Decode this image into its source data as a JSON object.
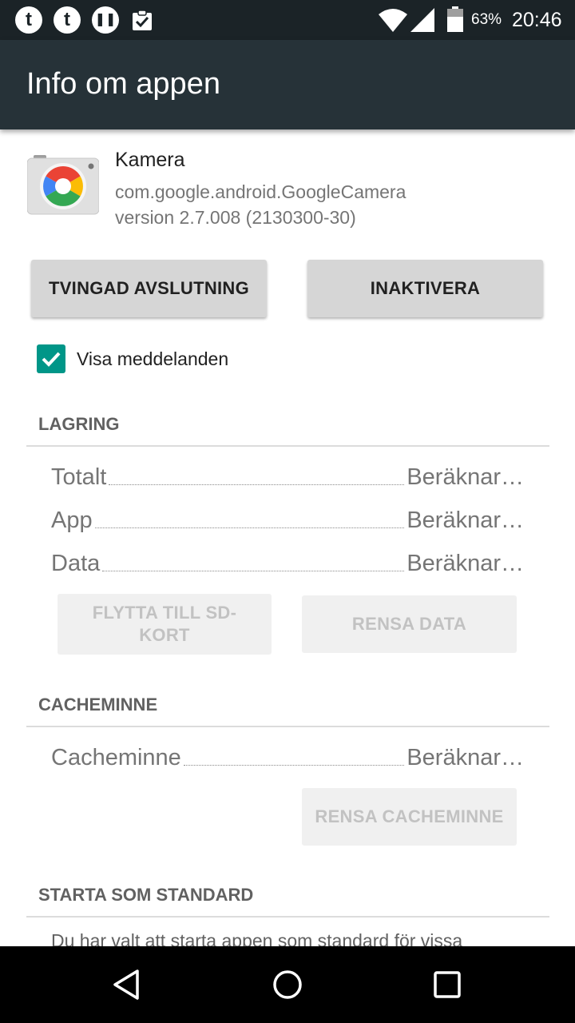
{
  "status_bar": {
    "notification_icons": [
      "tumblr-icon",
      "tumblr-icon",
      "pause-icon",
      "clipboard-check-icon"
    ],
    "battery": "63%",
    "time": "20:46"
  },
  "app_bar": {
    "title": "Info om appen"
  },
  "app": {
    "name": "Kamera",
    "package": "com.google.android.GoogleCamera",
    "version": "version 2.7.008 (2130300-30)"
  },
  "buttons": {
    "force_stop": "TVINGAD AVSLUTNING",
    "disable": "INAKTIVERA"
  },
  "notifications": {
    "label": "Visa meddelanden",
    "checked": true
  },
  "storage": {
    "title": "LAGRING",
    "rows": [
      {
        "label": "Totalt",
        "value": "Beräknar…"
      },
      {
        "label": "App",
        "value": "Beräknar…"
      },
      {
        "label": "Data",
        "value": "Beräknar…"
      }
    ],
    "move_button": "FLYTTA TILL SD-KORT",
    "clear_data_button": "RENSA DATA"
  },
  "cache": {
    "title": "CACHEMINNE",
    "row": {
      "label": "Cacheminne",
      "value": "Beräknar…"
    },
    "clear_cache_button": "RENSA CACHEMINNE"
  },
  "launch_default": {
    "title": "STARTA SOM STANDARD",
    "text": "Du har valt att starta appen som standard för vissa"
  },
  "colors": {
    "status_bar": "#1b2327",
    "app_bar": "#263238",
    "accent": "#009688"
  }
}
